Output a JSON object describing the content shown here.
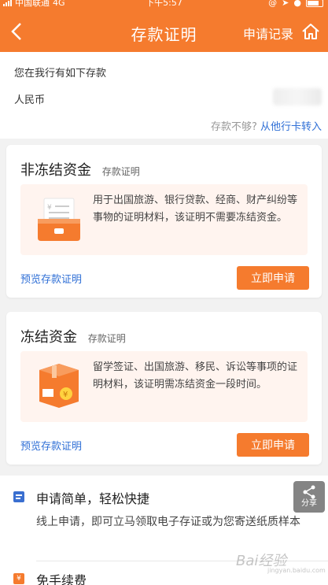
{
  "status_bar": {
    "carrier": "中国联通",
    "network": "4G",
    "time": "下午5:57"
  },
  "nav": {
    "title": "存款证明",
    "record": "申请记录"
  },
  "intro": {
    "line1": "您在我行有如下存款",
    "currency": "人民币",
    "hint_question": "存款不够?",
    "hint_link": "从他行卡转入"
  },
  "cards": [
    {
      "title": "非冻结资金",
      "subtitle": "存款证明",
      "description": "用于出国旅游、银行贷款、经商、财产纠纷等事物的证明材料，该证明不需要冻结资金。",
      "preview": "预览存款证明",
      "apply": "立即申请"
    },
    {
      "title": "冻结资金",
      "subtitle": "存款证明",
      "description": "留学签证、出国旅游、移民、诉讼等事项的证明材料，该证明需冻结资金一段时间。",
      "preview": "预览存款证明",
      "apply": "立即申请"
    }
  ],
  "features": [
    {
      "title": "申请简单，轻松快捷",
      "description": "线上申请，即可立马领取电子存证或为您寄送纸质样本",
      "icon": "document-icon"
    },
    {
      "title": "免手续费",
      "icon": "yen-icon"
    }
  ],
  "share": {
    "label": "分享"
  },
  "watermark": {
    "text": "Bai经验",
    "sub": "jingyan.baidu.com"
  },
  "colors": {
    "accent": "#f57b2e",
    "link": "#2f6fd6",
    "box_bg": "#fff4ef"
  }
}
